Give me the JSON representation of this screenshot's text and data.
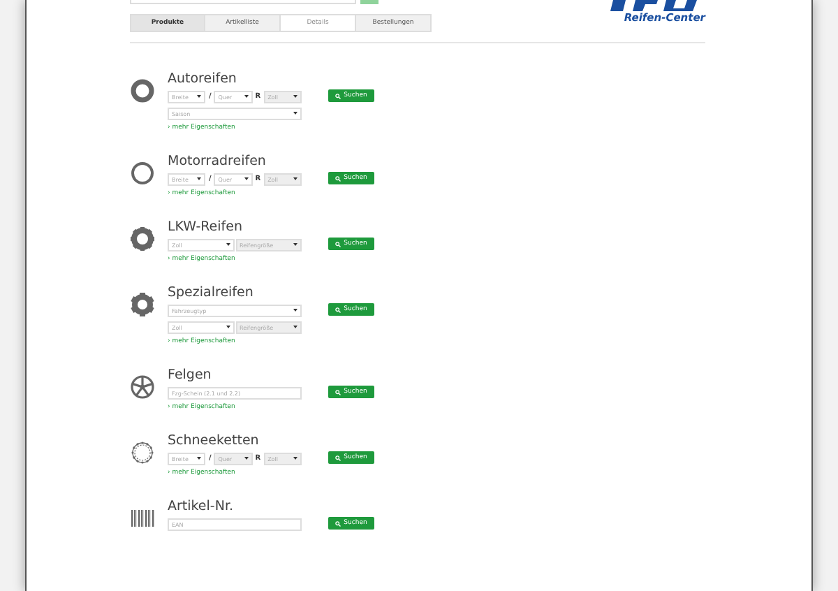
{
  "logo": {
    "subtitle": "Reifen-Center"
  },
  "tabs": [
    {
      "label": "Produkte",
      "selected": true,
      "disabled": false
    },
    {
      "label": "Artikelliste",
      "selected": false,
      "disabled": false
    },
    {
      "label": "Details",
      "selected": false,
      "disabled": true
    },
    {
      "label": "Bestellungen",
      "selected": false,
      "disabled": false
    }
  ],
  "sections": [
    {
      "kind": "car-tire",
      "title": "Autoreifen",
      "rows": [
        [
          {
            "kind": "select",
            "placeholder": "Breite",
            "disabled": false
          },
          {
            "kind": "separator",
            "text": "/"
          },
          {
            "kind": "select",
            "placeholder": "Quer",
            "disabled": false
          },
          {
            "kind": "separator",
            "text": "R"
          },
          {
            "kind": "select",
            "placeholder": "Zoll",
            "disabled": true
          }
        ],
        [
          {
            "kind": "select",
            "placeholder": "Saison",
            "disabled": false
          }
        ]
      ],
      "button": "Suchen",
      "link": "› mehr Eigenschaften"
    },
    {
      "kind": "moto-tire",
      "title": "Motorradreifen",
      "rows": [
        [
          {
            "kind": "select",
            "placeholder": "Breite",
            "disabled": false
          },
          {
            "kind": "separator",
            "text": "/"
          },
          {
            "kind": "select",
            "placeholder": "Quer",
            "disabled": false
          },
          {
            "kind": "separator",
            "text": "R"
          },
          {
            "kind": "select",
            "placeholder": "Zoll",
            "disabled": true
          }
        ]
      ],
      "button": "Suchen",
      "link": "› mehr Eigenschaften"
    },
    {
      "kind": "truck-tire",
      "title": "LKW-Reifen",
      "rows": [
        [
          {
            "kind": "select",
            "placeholder": "Zoll",
            "disabled": false
          },
          {
            "kind": "select",
            "placeholder": "Reifengröße",
            "disabled": true
          }
        ]
      ],
      "button": "Suchen",
      "link": "› mehr Eigenschaften"
    },
    {
      "kind": "special-tire",
      "title": "Spezialreifen",
      "rows": [
        [
          {
            "kind": "select",
            "placeholder": "Fahrzeugtyp",
            "disabled": false
          }
        ],
        [
          {
            "kind": "select",
            "placeholder": "Zoll",
            "disabled": false
          },
          {
            "kind": "select",
            "placeholder": "Reifengröße",
            "disabled": true
          }
        ]
      ],
      "button": "Suchen",
      "link": "› mehr Eigenschaften"
    },
    {
      "kind": "rim",
      "title": "Felgen",
      "rows": [
        [
          {
            "kind": "input",
            "placeholder": "Fzg-Schein (2.1 und 2.2)",
            "disabled": false
          }
        ]
      ],
      "button": "Suchen",
      "link": "› mehr Eigenschaften"
    },
    {
      "kind": "snow-chain",
      "title": "Schneeketten",
      "rows": [
        [
          {
            "kind": "select",
            "placeholder": "Breite",
            "disabled": false
          },
          {
            "kind": "separator",
            "text": "/"
          },
          {
            "kind": "select",
            "placeholder": "Quer",
            "disabled": true
          },
          {
            "kind": "separator",
            "text": "R"
          },
          {
            "kind": "select",
            "placeholder": "Zoll",
            "disabled": true
          }
        ]
      ],
      "button": "Suchen",
      "link": "› mehr Eigenschaften"
    },
    {
      "kind": "article",
      "title": "Artikel-Nr.",
      "rows": [
        [
          {
            "kind": "input",
            "placeholder": "EAN",
            "disabled": false
          }
        ]
      ],
      "button": "Suchen"
    }
  ]
}
